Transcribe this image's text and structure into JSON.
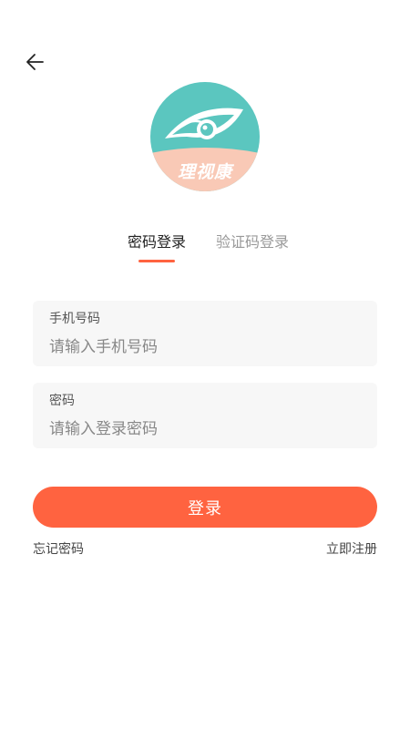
{
  "logo": {
    "text": "理视康"
  },
  "tabs": {
    "password_login": "密码登录",
    "code_login": "验证码登录"
  },
  "phone_field": {
    "label": "手机号码",
    "placeholder": "请输入手机号码"
  },
  "password_field": {
    "label": "密码",
    "placeholder": "请输入登录密码"
  },
  "login_button": "登录",
  "links": {
    "forgot_password": "忘记密码",
    "register": "立即注册"
  },
  "colors": {
    "accent": "#ff6340",
    "logo_teal": "#5bc6bf",
    "logo_peach": "#f9c9b6",
    "field_bg": "#f7f7f7"
  },
  "icons": {
    "back": "back-arrow-icon",
    "logo": "eye-leaf-logo-icon"
  }
}
